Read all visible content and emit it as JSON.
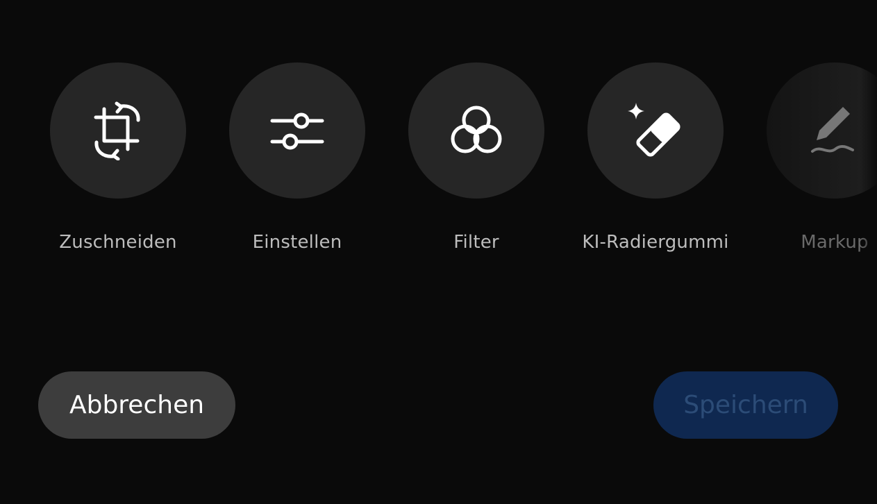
{
  "tools": [
    {
      "label": "Zuschneiden",
      "icon": "crop-rotate-icon"
    },
    {
      "label": "Einstellen",
      "icon": "sliders-icon"
    },
    {
      "label": "Filter",
      "icon": "filter-circles-icon"
    },
    {
      "label": "KI-Radiergummi",
      "icon": "ai-eraser-icon"
    },
    {
      "label": "Markup",
      "icon": "pen-markup-icon"
    }
  ],
  "actions": {
    "cancel_label": "Abbrechen",
    "save_label": "Speichern"
  },
  "colors": {
    "background": "#0a0a0a",
    "tool_circle": "#262626",
    "cancel_button": "#3d3d3d",
    "save_button_disabled": "#0f2850",
    "save_text_disabled": "#2c4c77"
  }
}
